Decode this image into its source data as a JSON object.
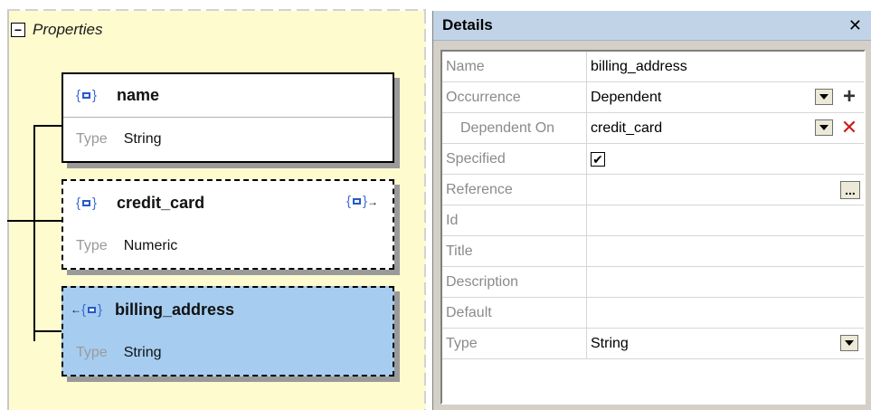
{
  "diagram": {
    "properties_label": "Properties",
    "collapse_symbol": "−",
    "nodes": [
      {
        "name": "name",
        "type_label": "Type",
        "type_value": "String",
        "icon": "property-icon"
      },
      {
        "name": "credit_card",
        "type_label": "Type",
        "type_value": "Numeric",
        "icon": "property-icon",
        "trailing_icon": "property-reference-out-icon"
      },
      {
        "name": "billing_address",
        "type_label": "Type",
        "type_value": "String",
        "icon": "property-reference-in-icon",
        "selected": true
      }
    ]
  },
  "details": {
    "title": "Details",
    "close_symbol": "✕",
    "rows": [
      {
        "key": "Name",
        "value": "billing_address"
      },
      {
        "key": "Occurrence",
        "value": "Dependent"
      },
      {
        "key": "Dependent On",
        "value": "credit_card"
      },
      {
        "key": "Specified",
        "value": "✔"
      },
      {
        "key": "Reference",
        "value": ""
      },
      {
        "key": "Id",
        "value": ""
      },
      {
        "key": "Title",
        "value": ""
      },
      {
        "key": "Description",
        "value": ""
      },
      {
        "key": "Default",
        "value": ""
      },
      {
        "key": "Type",
        "value": "String"
      }
    ],
    "plus_symbol": "+",
    "remove_symbol": "✕",
    "ellipsis_symbol": "...",
    "specified_checked": true
  },
  "colors": {
    "diagram_bg": "#fefbcf",
    "selected_node": "#a6cdf0",
    "details_header": "#c1d4e7",
    "remove_red": "#d11a1a",
    "icon_blue": "#2a59c5"
  }
}
